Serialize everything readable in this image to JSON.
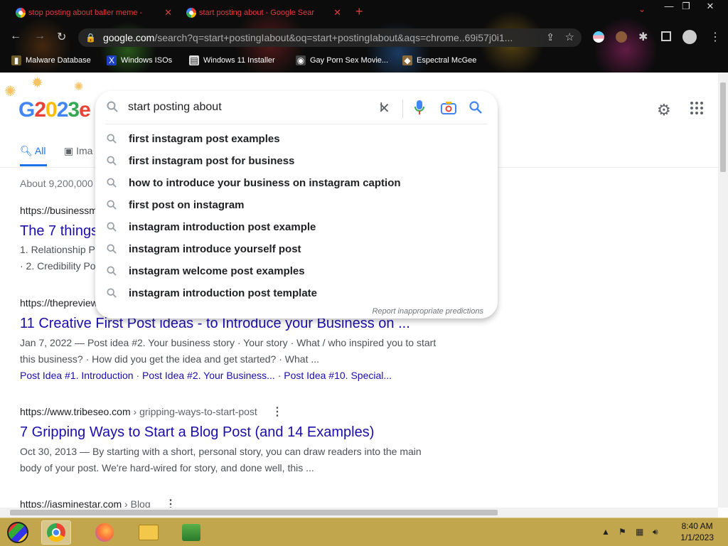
{
  "browser": {
    "tabs": [
      {
        "title": "stop posting about baller meme -"
      },
      {
        "title": "start posting about - Google Sear"
      }
    ],
    "new_tab": "+",
    "url_host": "google.com",
    "url_rest": "/search?q=start+postingIabout&oq=start+postingIabout&aqs=chrome..69i57j0i1...",
    "bookmarks": [
      "Malware Database",
      "Windows ISOs",
      "Windows 11 Installer",
      "Gay Porn Sex Movie...",
      "Espectral McGee"
    ]
  },
  "search": {
    "query": "start posting about",
    "suggestions": [
      "first instagram post examples",
      "first instagram post for business",
      "how to introduce your business on instagram caption",
      "first post on instagram",
      "instagram introduction post example",
      "instagram introduce yourself post",
      "instagram welcome post examples",
      "instagram introduction post template"
    ],
    "report_text": "Report inappropriate predictions"
  },
  "tabs": {
    "all": "All",
    "images": "Ima"
  },
  "stats": "About 9,200,000",
  "results": [
    {
      "url": "https://businessm",
      "title": "The 7 things",
      "snippet1": "1. Relationship P",
      "snippet2": "· 2. Credibility Po"
    },
    {
      "url": "https://thepreview",
      "title": "11 Creative First Post ideas - to Introduce your Business on ...",
      "snippet1": "Jan 7, 2022 — Post idea #2. Your business story · Your story · What / who inspired you to start",
      "snippet2": "this business? · How did you get the idea and get started? · What ...",
      "sitelinks": [
        "Post Idea #1. Introduction",
        "Post Idea #2. Your Business...",
        "Post Idea #10. Special..."
      ]
    },
    {
      "url_host": "https://www.tribeseo.com",
      "url_path": " › gripping-ways-to-start-post",
      "title": "7 Gripping Ways to Start a Blog Post (and 14 Examples)",
      "snippet1": "Oct 30, 2013 — By starting with a short, personal story, you can draw readers into the main",
      "snippet2": "body of your post. We're hard-wired for story, and done well, this ..."
    },
    {
      "url_host": "https://iasminestar.com",
      "url_path": " › Blog"
    }
  ],
  "taskbar": {
    "time": "8:40 AM",
    "date": "1/1/2023"
  },
  "colors": {
    "link": "#1a0dab",
    "accent": "#4285f4",
    "taskbar": "#c2a64e"
  }
}
